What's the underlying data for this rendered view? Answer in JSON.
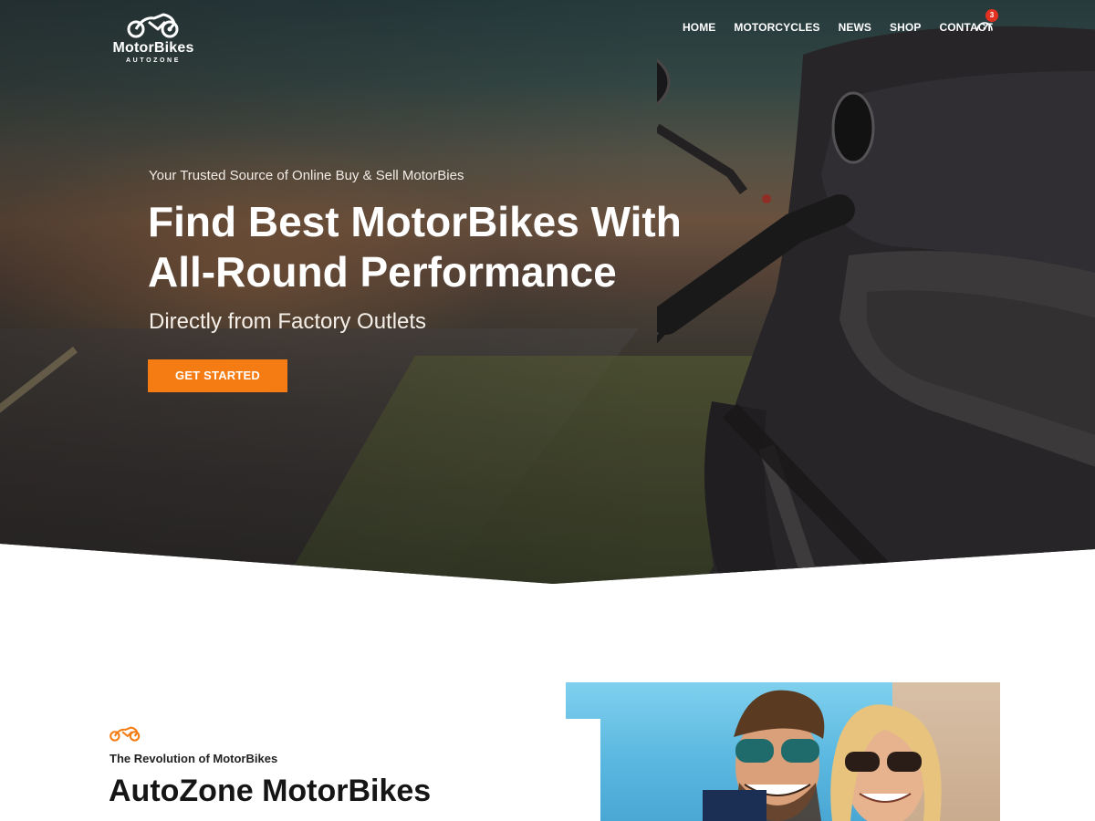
{
  "brand": {
    "name": "MotorBikes",
    "tagline": "AUTOZONE",
    "accent_color": "#f47c12",
    "logo_icon": "motorcycle-icon"
  },
  "nav": {
    "items": [
      {
        "label": "HOME"
      },
      {
        "label": "MOTORCYCLES"
      },
      {
        "label": "NEWS"
      },
      {
        "label": "SHOP"
      },
      {
        "label": "CONTACT"
      }
    ],
    "gauge_icon": "speedometer-icon",
    "badge_count": "3",
    "badge_color": "#e23120"
  },
  "hero": {
    "kicker": "Your Trusted Source of Online Buy & Sell MotorBies",
    "title": "Find Best MotorBikes With All-Round Performance",
    "subtitle": "Directly from Factory Outlets",
    "cta_label": "GET STARTED"
  },
  "about": {
    "icon": "motorcycle-icon",
    "kicker": "The Revolution of MotorBikes",
    "title": "AutoZone MotorBikes"
  }
}
